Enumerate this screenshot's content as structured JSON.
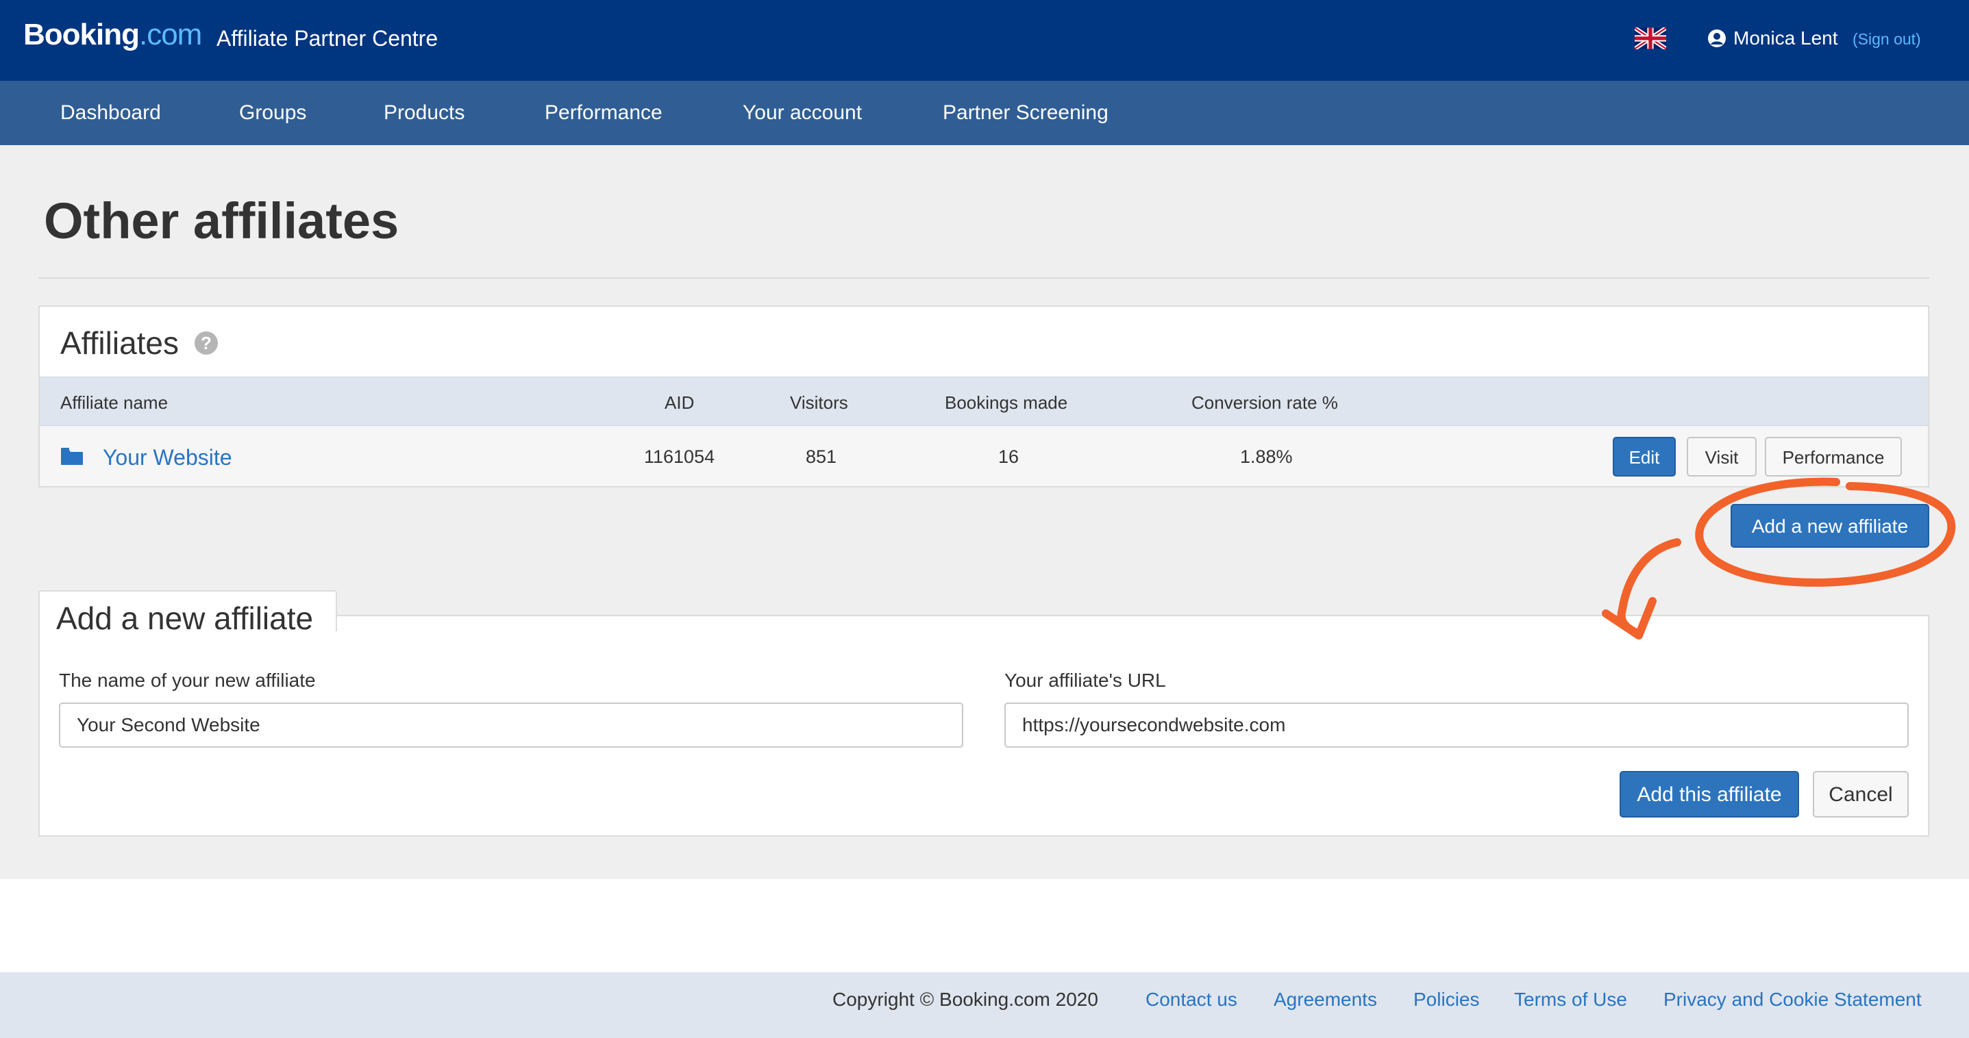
{
  "header": {
    "logo_brand": "Booking",
    "logo_tld": ".com",
    "app_title": "Affiliate Partner Centre",
    "flag_icon": "uk-flag-icon",
    "user_name": "Monica Lent",
    "sign_out_label": "(Sign out)"
  },
  "nav": {
    "items": [
      "Dashboard",
      "Groups",
      "Products",
      "Performance",
      "Your account",
      "Partner Screening"
    ]
  },
  "page": {
    "title": "Other affiliates"
  },
  "affiliates": {
    "panel_title": "Affiliates",
    "help_glyph": "?",
    "columns": [
      "Affiliate name",
      "AID",
      "Visitors",
      "Bookings made",
      "Conversion rate %"
    ],
    "rows": [
      {
        "name": "Your Website",
        "aid": "1161054",
        "visitors": "851",
        "bookings": "16",
        "conversion": "1.88%",
        "actions": [
          "Edit",
          "Visit",
          "Performance"
        ]
      }
    ],
    "add_new_label": "Add a new affiliate"
  },
  "form": {
    "title": "Add a new affiliate",
    "name_label": "The name of your new affiliate",
    "name_value": "Your Second Website",
    "url_label": "Your affiliate's URL",
    "url_value": "https://yoursecondwebsite.com",
    "submit_label": "Add this affiliate",
    "cancel_label": "Cancel"
  },
  "footer": {
    "copyright": "Copyright © Booking.com 2020",
    "links": [
      "Contact us",
      "Agreements",
      "Policies",
      "Terms of Use",
      "Privacy and Cookie Statement"
    ]
  },
  "colors": {
    "brand_dark": "#003580",
    "nav_bg": "#305e94",
    "link_blue": "#2874c2",
    "primary_button": "#2e74bc",
    "annotation_orange": "#f2622b"
  }
}
